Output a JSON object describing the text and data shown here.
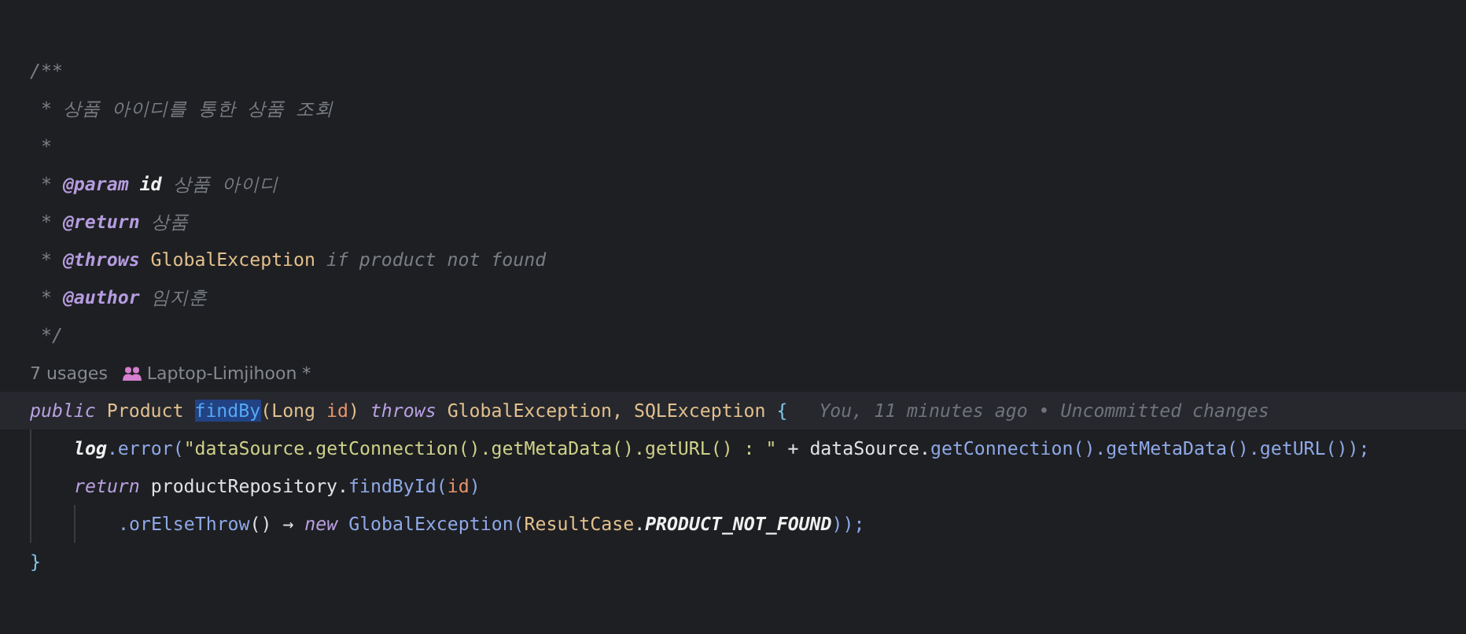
{
  "doc_comment": [
    [
      {
        "text": "/**",
        "kind": "comment"
      }
    ],
    [
      {
        "text": " * 상품 아이디를 통한 상품 조회",
        "kind": "comment"
      }
    ],
    [
      {
        "text": " *",
        "kind": "comment"
      }
    ],
    [
      {
        "text": " * ",
        "kind": "comment"
      },
      {
        "text": "@param ",
        "kind": "doc-tag"
      },
      {
        "text": "id",
        "kind": "doc-param"
      },
      {
        "text": " 상품 아이디",
        "kind": "comment"
      }
    ],
    [
      {
        "text": " * ",
        "kind": "comment"
      },
      {
        "text": "@return",
        "kind": "doc-tag"
      },
      {
        "text": " 상품",
        "kind": "comment"
      }
    ],
    [
      {
        "text": " * ",
        "kind": "comment"
      },
      {
        "text": "@throws ",
        "kind": "doc-tag"
      },
      {
        "text": "GlobalException",
        "kind": "type"
      },
      {
        "text": " if product not found",
        "kind": "comment"
      }
    ],
    [
      {
        "text": " * ",
        "kind": "comment"
      },
      {
        "text": "@author",
        "kind": "doc-tag"
      },
      {
        "text": " 임지훈",
        "kind": "comment"
      }
    ],
    [
      {
        "text": " */",
        "kind": "comment"
      }
    ]
  ],
  "inlay": {
    "usages": "7 usages",
    "author": "Laptop-Limjihoon *"
  },
  "code": [
    {
      "current": true,
      "blame": "You, 11 minutes ago • Uncommitted changes",
      "tokens": [
        {
          "text": "public ",
          "kind": "keyword"
        },
        {
          "text": "Product ",
          "kind": "type"
        },
        {
          "text": "findBy",
          "kind": "declaration"
        },
        {
          "text": "(Long ",
          "kind": "type"
        },
        {
          "text": "id",
          "kind": "param"
        },
        {
          "text": ") ",
          "kind": "type"
        },
        {
          "text": "throws ",
          "kind": "keyword"
        },
        {
          "text": "GlobalException, SQLException ",
          "kind": "type"
        },
        {
          "text": "{",
          "kind": "brace"
        }
      ],
      "children": [
        {
          "current": false,
          "tokens": [
            {
              "text": "log",
              "kind": "static-field"
            },
            {
              "text": ".error(",
              "kind": "method"
            },
            {
              "text": "\"dataSource.getConnection().getMetaData().getURL() : \"",
              "kind": "string"
            },
            {
              "text": " + dataSource.",
              "kind": "plain"
            },
            {
              "text": "getConnection().getMetaData().getURL());",
              "kind": "method"
            }
          ]
        },
        {
          "current": false,
          "tokens": [
            {
              "text": "return",
              "kind": "keyword"
            },
            {
              "text": " productRepository.",
              "kind": "plain"
            },
            {
              "text": "findById(",
              "kind": "method"
            },
            {
              "text": "id",
              "kind": "param"
            },
            {
              "text": ")",
              "kind": "method"
            }
          ],
          "children": [
            {
              "current": false,
              "tokens": [
                {
                  "text": ".orElseThrow",
                  "kind": "method"
                },
                {
                  "text": "() → ",
                  "kind": "plain"
                },
                {
                  "text": "new ",
                  "kind": "keyword"
                },
                {
                  "text": "GlobalException(",
                  "kind": "method"
                },
                {
                  "text": "ResultCase",
                  "kind": "type"
                },
                {
                  "text": ".",
                  "kind": "plain"
                },
                {
                  "text": "PRODUCT_NOT_FOUND",
                  "kind": "constant"
                },
                {
                  "text": "));",
                  "kind": "method"
                }
              ]
            }
          ]
        }
      ]
    },
    {
      "current": false,
      "tokens": [
        {
          "text": "}",
          "kind": "brace"
        }
      ]
    }
  ]
}
